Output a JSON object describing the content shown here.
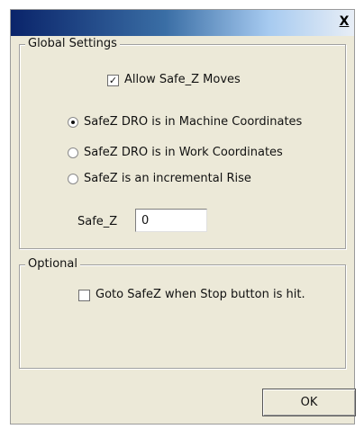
{
  "window": {
    "close_label": "X"
  },
  "global_settings": {
    "legend": "Global Settings",
    "allow_safe_z": {
      "label": "Allow Safe_Z Moves",
      "checked": true,
      "mark": "✓"
    },
    "radios": [
      {
        "label": "SafeZ DRO is in Machine Coordinates",
        "checked": true
      },
      {
        "label": "SafeZ DRO is in Work Coordinates",
        "checked": false
      },
      {
        "label": "SafeZ is an incremental Rise",
        "checked": false
      }
    ],
    "safe_z": {
      "label": "Safe_Z",
      "value": "0"
    }
  },
  "optional": {
    "legend": "Optional",
    "goto_safez": {
      "label": "Goto SafeZ when Stop button is hit.",
      "checked": false
    }
  },
  "buttons": {
    "ok_label": "OK"
  }
}
